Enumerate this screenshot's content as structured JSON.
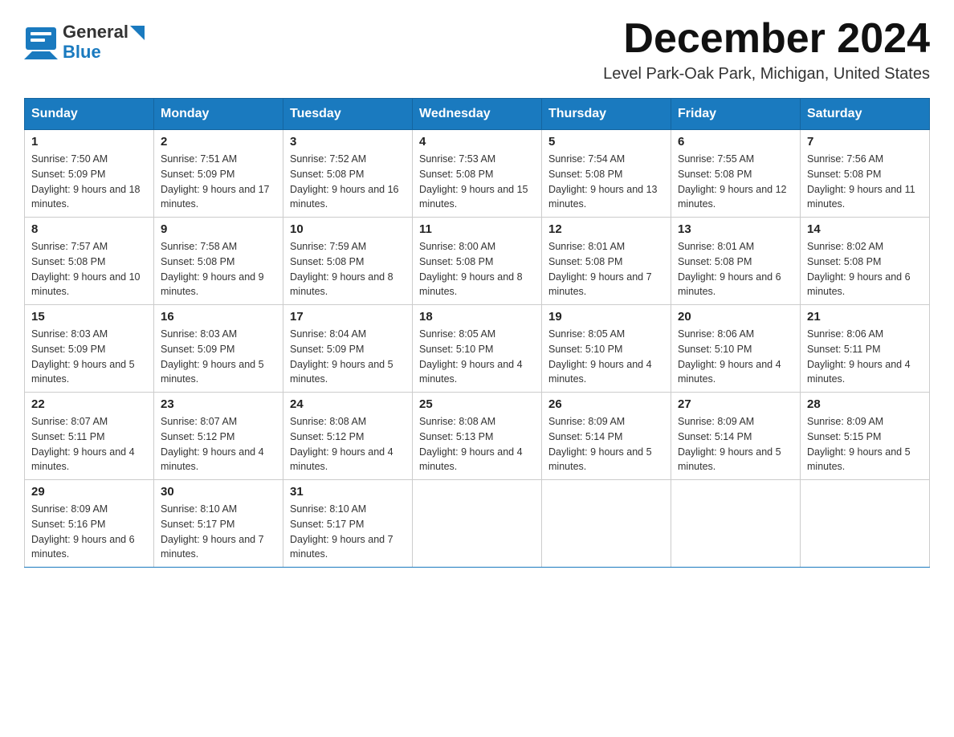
{
  "header": {
    "logo_general": "General",
    "logo_blue": "Blue",
    "month_title": "December 2024",
    "location": "Level Park-Oak Park, Michigan, United States"
  },
  "weekdays": [
    "Sunday",
    "Monday",
    "Tuesday",
    "Wednesday",
    "Thursday",
    "Friday",
    "Saturday"
  ],
  "weeks": [
    [
      {
        "day": "1",
        "sunrise": "7:50 AM",
        "sunset": "5:09 PM",
        "daylight": "9 hours and 18 minutes."
      },
      {
        "day": "2",
        "sunrise": "7:51 AM",
        "sunset": "5:09 PM",
        "daylight": "9 hours and 17 minutes."
      },
      {
        "day": "3",
        "sunrise": "7:52 AM",
        "sunset": "5:08 PM",
        "daylight": "9 hours and 16 minutes."
      },
      {
        "day": "4",
        "sunrise": "7:53 AM",
        "sunset": "5:08 PM",
        "daylight": "9 hours and 15 minutes."
      },
      {
        "day": "5",
        "sunrise": "7:54 AM",
        "sunset": "5:08 PM",
        "daylight": "9 hours and 13 minutes."
      },
      {
        "day": "6",
        "sunrise": "7:55 AM",
        "sunset": "5:08 PM",
        "daylight": "9 hours and 12 minutes."
      },
      {
        "day": "7",
        "sunrise": "7:56 AM",
        "sunset": "5:08 PM",
        "daylight": "9 hours and 11 minutes."
      }
    ],
    [
      {
        "day": "8",
        "sunrise": "7:57 AM",
        "sunset": "5:08 PM",
        "daylight": "9 hours and 10 minutes."
      },
      {
        "day": "9",
        "sunrise": "7:58 AM",
        "sunset": "5:08 PM",
        "daylight": "9 hours and 9 minutes."
      },
      {
        "day": "10",
        "sunrise": "7:59 AM",
        "sunset": "5:08 PM",
        "daylight": "9 hours and 8 minutes."
      },
      {
        "day": "11",
        "sunrise": "8:00 AM",
        "sunset": "5:08 PM",
        "daylight": "9 hours and 8 minutes."
      },
      {
        "day": "12",
        "sunrise": "8:01 AM",
        "sunset": "5:08 PM",
        "daylight": "9 hours and 7 minutes."
      },
      {
        "day": "13",
        "sunrise": "8:01 AM",
        "sunset": "5:08 PM",
        "daylight": "9 hours and 6 minutes."
      },
      {
        "day": "14",
        "sunrise": "8:02 AM",
        "sunset": "5:08 PM",
        "daylight": "9 hours and 6 minutes."
      }
    ],
    [
      {
        "day": "15",
        "sunrise": "8:03 AM",
        "sunset": "5:09 PM",
        "daylight": "9 hours and 5 minutes."
      },
      {
        "day": "16",
        "sunrise": "8:03 AM",
        "sunset": "5:09 PM",
        "daylight": "9 hours and 5 minutes."
      },
      {
        "day": "17",
        "sunrise": "8:04 AM",
        "sunset": "5:09 PM",
        "daylight": "9 hours and 5 minutes."
      },
      {
        "day": "18",
        "sunrise": "8:05 AM",
        "sunset": "5:10 PM",
        "daylight": "9 hours and 4 minutes."
      },
      {
        "day": "19",
        "sunrise": "8:05 AM",
        "sunset": "5:10 PM",
        "daylight": "9 hours and 4 minutes."
      },
      {
        "day": "20",
        "sunrise": "8:06 AM",
        "sunset": "5:10 PM",
        "daylight": "9 hours and 4 minutes."
      },
      {
        "day": "21",
        "sunrise": "8:06 AM",
        "sunset": "5:11 PM",
        "daylight": "9 hours and 4 minutes."
      }
    ],
    [
      {
        "day": "22",
        "sunrise": "8:07 AM",
        "sunset": "5:11 PM",
        "daylight": "9 hours and 4 minutes."
      },
      {
        "day": "23",
        "sunrise": "8:07 AM",
        "sunset": "5:12 PM",
        "daylight": "9 hours and 4 minutes."
      },
      {
        "day": "24",
        "sunrise": "8:08 AM",
        "sunset": "5:12 PM",
        "daylight": "9 hours and 4 minutes."
      },
      {
        "day": "25",
        "sunrise": "8:08 AM",
        "sunset": "5:13 PM",
        "daylight": "9 hours and 4 minutes."
      },
      {
        "day": "26",
        "sunrise": "8:09 AM",
        "sunset": "5:14 PM",
        "daylight": "9 hours and 5 minutes."
      },
      {
        "day": "27",
        "sunrise": "8:09 AM",
        "sunset": "5:14 PM",
        "daylight": "9 hours and 5 minutes."
      },
      {
        "day": "28",
        "sunrise": "8:09 AM",
        "sunset": "5:15 PM",
        "daylight": "9 hours and 5 minutes."
      }
    ],
    [
      {
        "day": "29",
        "sunrise": "8:09 AM",
        "sunset": "5:16 PM",
        "daylight": "9 hours and 6 minutes."
      },
      {
        "day": "30",
        "sunrise": "8:10 AM",
        "sunset": "5:17 PM",
        "daylight": "9 hours and 7 minutes."
      },
      {
        "day": "31",
        "sunrise": "8:10 AM",
        "sunset": "5:17 PM",
        "daylight": "9 hours and 7 minutes."
      },
      null,
      null,
      null,
      null
    ]
  ]
}
